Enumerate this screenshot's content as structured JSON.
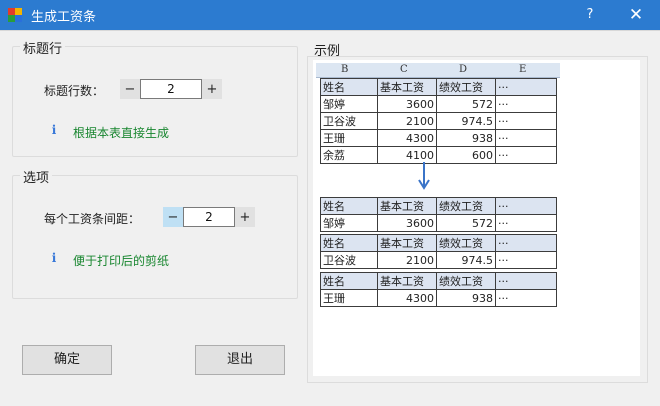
{
  "window": {
    "title": "生成工资条",
    "help_label": "?",
    "close_label": "✕"
  },
  "header_rows": {
    "group_title": "标题行",
    "count_label": "标题行数：",
    "count_value": "2",
    "minus_label": "−",
    "plus_label": "+",
    "info_icon": "i",
    "hint": "根据本表直接生成"
  },
  "options": {
    "group_title": "选项",
    "spacing_label": "每个工资条间距：",
    "spacing_value": "2",
    "minus_label": "−",
    "plus_label": "+",
    "info_icon": "i",
    "hint": "便于打印后的剪纸"
  },
  "buttons": {
    "ok": "确定",
    "exit": "退出"
  },
  "example": {
    "title": "示例",
    "column_letters": [
      "B",
      "C",
      "D",
      "E"
    ],
    "headers": [
      "姓名",
      "基本工资",
      "绩效工资",
      "···"
    ],
    "source_rows": [
      [
        "邹婷",
        "3600",
        "572",
        "···"
      ],
      [
        "卫谷波",
        "2100",
        "974.5",
        "···"
      ],
      [
        "王珊",
        "4300",
        "938",
        "···"
      ],
      [
        "余荔",
        "4100",
        "600",
        "···"
      ]
    ],
    "slips": [
      [
        "邹婷",
        "3600",
        "572",
        "···"
      ],
      [
        "卫谷波",
        "2100",
        "974.5",
        "···"
      ],
      [
        "王珊",
        "4300",
        "938",
        "···"
      ]
    ],
    "arrow_color": "#3a74c8"
  },
  "colors": {
    "titlebar": "#2c7bd0",
    "hint_text": "#18862f",
    "info_icon": "#3878d8"
  }
}
